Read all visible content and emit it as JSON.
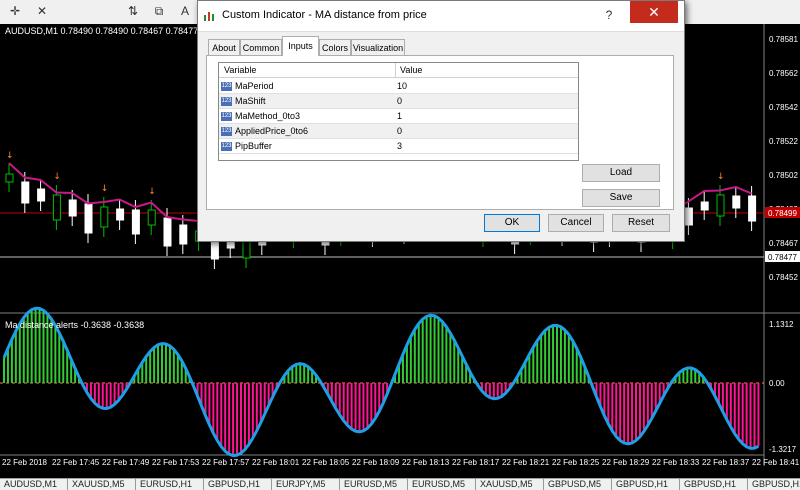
{
  "chart": {
    "main_label": "AUDUSD,M1  0.78490 0.78490 0.78467 0.78477",
    "sub_label": "Ma distance alerts -0.3638 -0.3638",
    "price_axis": [
      "0.78581",
      "0.78562",
      "0.78542",
      "0.78522",
      "0.78502",
      "0.78482",
      "0.78467",
      "0.78452"
    ],
    "current_price": "0.78477",
    "red_price": "0.78499",
    "sub_axis": [
      "1.1312",
      "0.00",
      "-1.3217"
    ],
    "time_axis": [
      "22 Feb 2018",
      "22 Feb 17:45",
      "22 Feb 17:49",
      "22 Feb 17:53",
      "22 Feb 17:57",
      "22 Feb 18:01",
      "22 Feb 18:05",
      "22 Feb 18:09",
      "22 Feb 18:13",
      "22 Feb 18:17",
      "22 Feb 18:21",
      "22 Feb 18:25",
      "22 Feb 18:29",
      "22 Feb 18:33",
      "22 Feb 18:37",
      "22 Feb 18:41"
    ],
    "colors": {
      "ma_line": "#c8188a",
      "bull": "#ffffff",
      "bear": "#00c000",
      "histo_pos": "#33cc33",
      "histo_neg": "#ff1493",
      "sub_line": "#1ea0e6",
      "level_red": "#c00000"
    }
  },
  "dialog": {
    "title": "Custom Indicator - MA distance from price",
    "help_label": "?",
    "close_label": "✕",
    "tabs": [
      "About",
      "Common",
      "Inputs",
      "Colors",
      "Visualization"
    ],
    "active_tab": "Inputs",
    "table_headers": {
      "variable": "Variable",
      "value": "Value"
    },
    "params": [
      {
        "name": "MaPeriod",
        "value": "10",
        "icon": "123"
      },
      {
        "name": "MaShift",
        "value": "0",
        "icon": "123"
      },
      {
        "name": "MaMethod_0to3",
        "value": "1",
        "icon": "123"
      },
      {
        "name": "AppliedPrice_0to6",
        "value": "0",
        "icon": "123"
      },
      {
        "name": "PipBuffer",
        "value": "3",
        "icon": "123"
      }
    ],
    "buttons": {
      "load": "Load",
      "save": "Save",
      "ok": "OK",
      "cancel": "Cancel",
      "reset": "Reset"
    }
  },
  "bottom_tabs": [
    "AUDUSD,M1",
    "XAUUSD,M5",
    "EURUSD,H1",
    "GBPUSD,H1",
    "EURJPY,M5",
    "EURUSD,M5",
    "EURUSD,M5",
    "XAUUSD,M5",
    "GBPUSD,M5",
    "GBPUSD,H1",
    "GBPUSD,H1",
    "GBPUSD,H1",
    "GBPU"
  ],
  "toolbar_icons": [
    "crosshair-icon",
    "zoom-icon",
    "sync-icon",
    "period-icon",
    "chart-line-icon"
  ]
}
